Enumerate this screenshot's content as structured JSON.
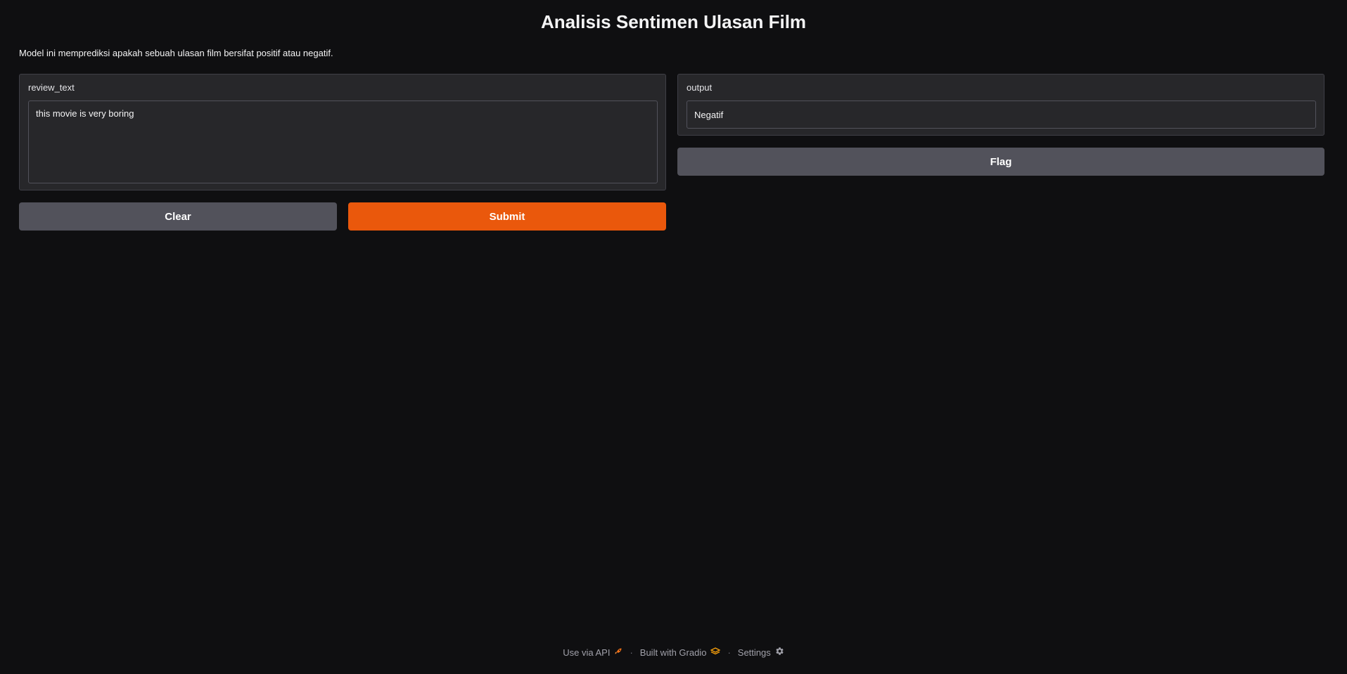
{
  "page": {
    "title": "Analisis Sentimen Ulasan Film",
    "description": "Model ini memprediksi apakah sebuah ulasan film bersifat positif atau negatif."
  },
  "input": {
    "label": "review_text",
    "value": "this movie is very boring"
  },
  "output": {
    "label": "output",
    "value": "Negatif"
  },
  "buttons": {
    "clear": "Clear",
    "submit": "Submit",
    "flag": "Flag"
  },
  "footer": {
    "api": "Use via API",
    "separator": "·",
    "built_with": "Built with Gradio",
    "settings": "Settings"
  },
  "colors": {
    "accent": "#ea580c",
    "background": "#0f0f11",
    "panel": "#27272a",
    "secondary_button": "#52525b"
  },
  "icons": {
    "api": "rocket-icon",
    "gradio": "gradio-logo-icon",
    "settings": "gear-icon"
  }
}
